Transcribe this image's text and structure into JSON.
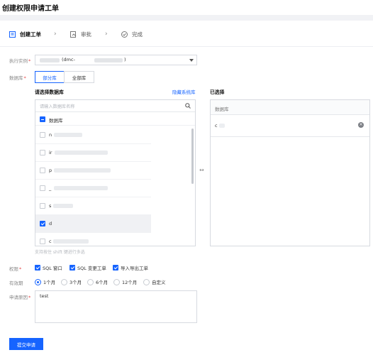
{
  "page": {
    "title": "创建权限申请工单"
  },
  "steps": [
    {
      "label": "创建工单",
      "icon": "document-icon",
      "active": true
    },
    {
      "label": "审批",
      "icon": "approve-icon",
      "active": false
    },
    {
      "label": "完成",
      "icon": "check-circle-icon",
      "active": false
    }
  ],
  "form": {
    "instance": {
      "label": "执行实例",
      "value_mid": "(dmc-",
      "value_end": ")"
    },
    "database": {
      "label": "数据库",
      "segments": [
        "部分库",
        "全部库"
      ],
      "active_segment": "部分库"
    },
    "selector": {
      "left_title": "请选择数据库",
      "hide_system_link": "隐藏系统库",
      "search_placeholder": "请输入数据库名称",
      "header_label": "数据库",
      "rows": [
        {
          "prefix": "n",
          "checked": false
        },
        {
          "prefix": "ir",
          "checked": false
        },
        {
          "prefix": "p",
          "checked": false
        },
        {
          "prefix": "_",
          "checked": false
        },
        {
          "prefix": "s",
          "checked": false
        },
        {
          "prefix": "d",
          "checked": true
        },
        {
          "prefix": "c",
          "checked": false
        }
      ],
      "hint": "支持按住 shift 键进行多选",
      "right_title": "已选择",
      "right_header": "数据库",
      "selected": [
        {
          "prefix": "c"
        }
      ],
      "swap_icon": "swap-icon"
    },
    "permissions": {
      "label": "权限",
      "options": [
        {
          "label": "SQL 窗口",
          "checked": true
        },
        {
          "label": "SQL 变更工单",
          "checked": true
        },
        {
          "label": "导入导出工单",
          "checked": true
        }
      ]
    },
    "validity": {
      "label": "有效期",
      "options": [
        "1个月",
        "3个月",
        "6个月",
        "12个月",
        "自定义"
      ],
      "selected": "1个月"
    },
    "reason": {
      "label": "申请原因",
      "value": "test"
    },
    "submit_label": "提交申请"
  }
}
